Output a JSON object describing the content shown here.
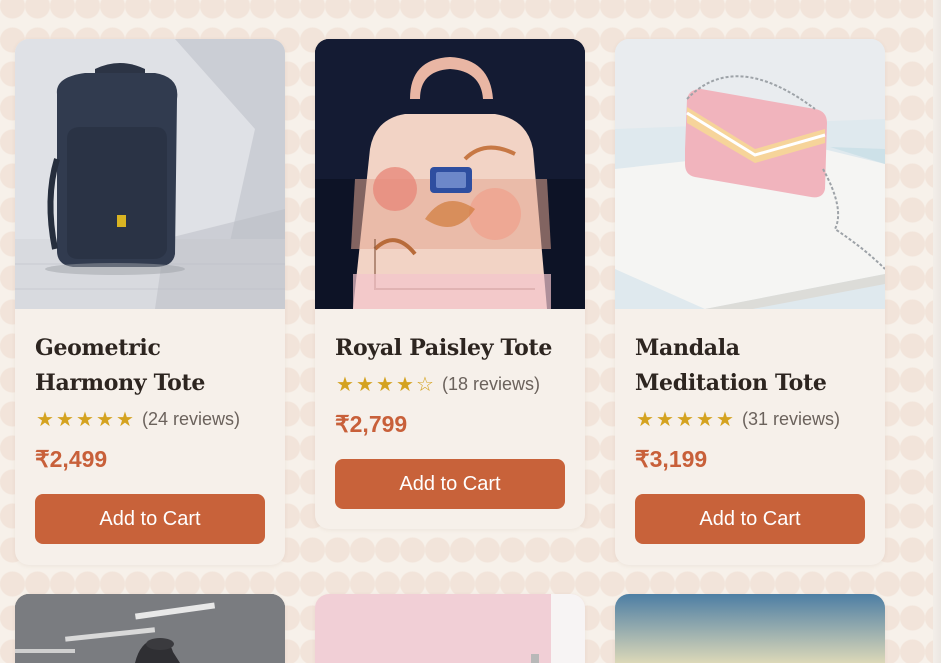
{
  "products": [
    {
      "title": "Geometric Harmony Tote",
      "rating": 5,
      "stars": [
        "★",
        "★",
        "★",
        "★",
        "★"
      ],
      "reviews": "(24 reviews)",
      "price": "₹2,499",
      "button": "Add to Cart",
      "image": "navy-backpack"
    },
    {
      "title": "Royal Paisley Tote",
      "rating": 4,
      "stars": [
        "★",
        "★",
        "★",
        "★",
        "☆"
      ],
      "reviews": "(18 reviews)",
      "price": "₹2,799",
      "button": "Add to Cart",
      "image": "floral-handbag"
    },
    {
      "title": "Mandala Meditation Tote",
      "rating": 5,
      "stars": [
        "★",
        "★",
        "★",
        "★",
        "★"
      ],
      "reviews": "(31 reviews)",
      "price": "₹3,199",
      "button": "Add to Cart",
      "image": "pink-shoulder-bag"
    }
  ],
  "colors": {
    "accent": "#c8623a",
    "price": "#c8603a",
    "star": "#d4a21f",
    "background": "#f7f1ea"
  }
}
